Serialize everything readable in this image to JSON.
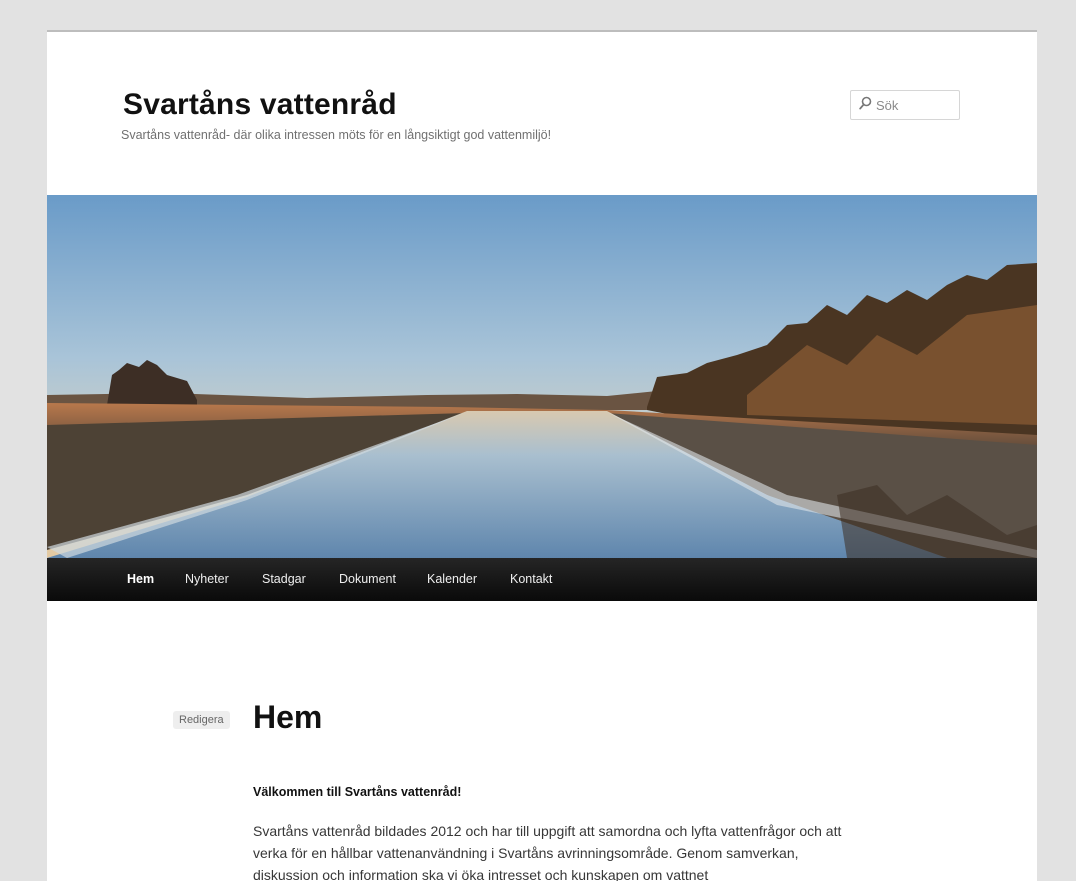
{
  "header": {
    "site_title": "Svartåns vattenråd",
    "site_description": "Svartåns vattenråd- där olika intressen möts för en långsiktigt god vattenmiljö!"
  },
  "search": {
    "placeholder": "Sök",
    "icon": "search-icon"
  },
  "banner": {
    "icon": "landscape-photo",
    "subject": "river landscape at sunset"
  },
  "nav": {
    "items": [
      {
        "label": "Hem",
        "active": true
      },
      {
        "label": "Nyheter"
      },
      {
        "label": "Stadgar"
      },
      {
        "label": "Dokument"
      },
      {
        "label": "Kalender"
      },
      {
        "label": "Kontakt"
      }
    ]
  },
  "article": {
    "edit_label": "Redigera",
    "title": "Hem",
    "welcome": "Välkommen till Svartåns vattenråd!",
    "paragraph": "Svartåns vattenråd bildades 2012 och har till uppgift att samordna och lyfta vattenfrågor och att verka för en hållbar vattenanvändning i Svartåns avrinningsområde. Genom samverkan, diskussion och information ska vi öka intresset och kunskapen om vattnet"
  },
  "colors": {
    "page_bg": "#e2e2e2",
    "nav_bg": "#222222",
    "title": "#111111"
  }
}
